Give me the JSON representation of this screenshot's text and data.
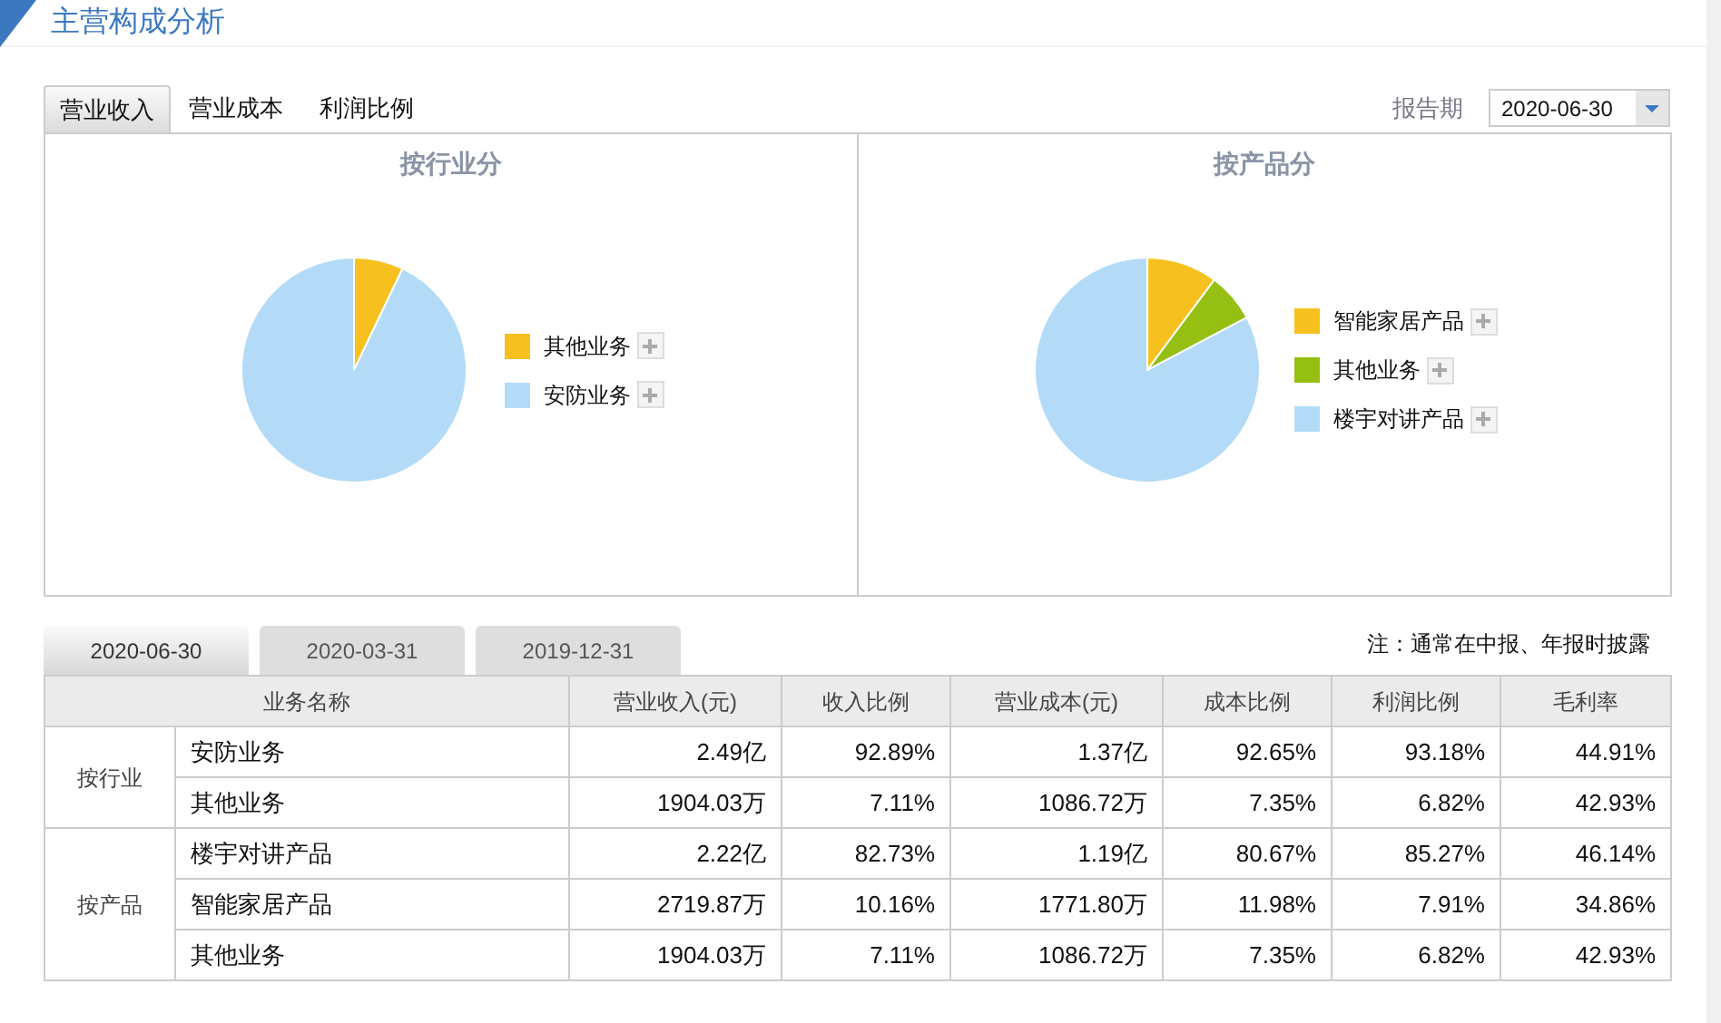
{
  "section_title": "主营构成分析",
  "metric_tabs": [
    {
      "label": "营业收入",
      "selected": true
    },
    {
      "label": "营业成本",
      "selected": false
    },
    {
      "label": "利润比例",
      "selected": false
    }
  ],
  "report_period": {
    "label": "报告期",
    "value": "2020-06-30"
  },
  "charts": [
    {
      "title": "按行业分",
      "legend": [
        {
          "color": "#f6c11f"
        },
        {
          "color": "#b3dbf8"
        }
      ],
      "chart_data": {
        "type": "pie",
        "categories": [
          "其他业务",
          "安防业务"
        ],
        "values": [
          7.11,
          92.89
        ]
      }
    },
    {
      "title": "按产品分",
      "legend": [
        {
          "color": "#f6c11f"
        },
        {
          "color": "#95bf12"
        },
        {
          "color": "#b3dbf8"
        }
      ],
      "chart_data": {
        "type": "pie",
        "categories": [
          "智能家居产品",
          "其他业务",
          "楼宇对讲产品"
        ],
        "values": [
          10.16,
          7.11,
          82.73
        ]
      }
    }
  ],
  "date_tabs": [
    {
      "label": "2020-06-30",
      "selected": true
    },
    {
      "label": "2020-03-31",
      "selected": false
    },
    {
      "label": "2019-12-31",
      "selected": false
    }
  ],
  "note": "注：通常在中报、年报时披露",
  "table": {
    "columns": [
      "业务名称",
      "营业收入(元)",
      "收入比例",
      "营业成本(元)",
      "成本比例",
      "利润比例",
      "毛利率"
    ],
    "groups": [
      {
        "label": "按行业",
        "rows": [
          [
            "安防业务",
            "2.49亿",
            "92.89%",
            "1.37亿",
            "92.65%",
            "93.18%",
            "44.91%"
          ],
          [
            "其他业务",
            "1904.03万",
            "7.11%",
            "1086.72万",
            "7.35%",
            "6.82%",
            "42.93%"
          ]
        ]
      },
      {
        "label": "按产品",
        "rows": [
          [
            "楼宇对讲产品",
            "2.22亿",
            "82.73%",
            "1.19亿",
            "80.67%",
            "85.27%",
            "46.14%"
          ],
          [
            "智能家居产品",
            "2719.87万",
            "10.16%",
            "1771.80万",
            "11.98%",
            "7.91%",
            "34.86%"
          ],
          [
            "其他业务",
            "1904.03万",
            "7.11%",
            "1086.72万",
            "7.35%",
            "6.82%",
            "42.93%"
          ]
        ]
      }
    ]
  }
}
